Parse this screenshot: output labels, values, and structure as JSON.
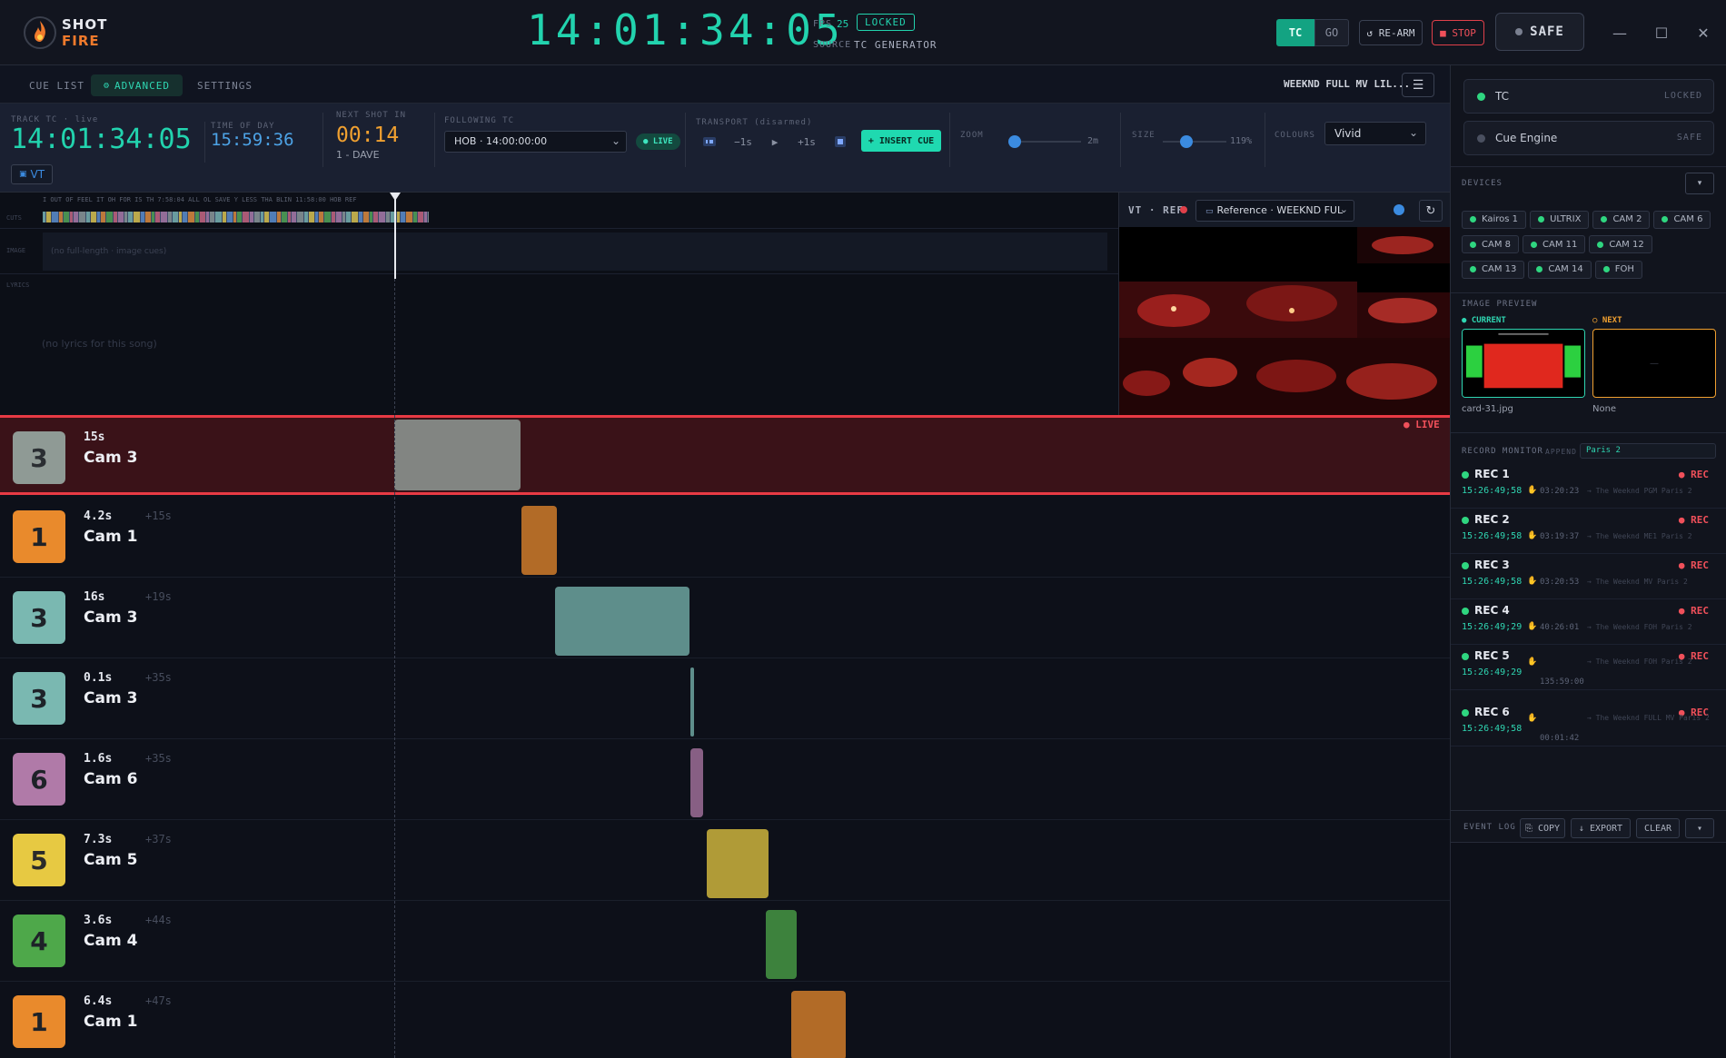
{
  "brand": {
    "line1": "SHOT",
    "line2": "FIRE"
  },
  "header": {
    "timecode": "14:01:34:05",
    "fps_label": "FPS",
    "fps_value": "25",
    "lock_status": "LOCKED",
    "source_label": "SOURCE",
    "source_value": "TC GENERATOR",
    "tc_button": "TC",
    "go_button": "GO",
    "rearm_button": "↺ RE-ARM",
    "stop_button": "■ STOP",
    "safe_button": "SAFE",
    "window": {
      "minimize": "—",
      "maximize": "☐",
      "close": "✕"
    }
  },
  "tabs": [
    {
      "label": "CUE LIST",
      "active": false
    },
    {
      "label": "ADVANCED",
      "active": true
    },
    {
      "label": "SETTINGS",
      "active": false
    }
  ],
  "song_title": "WEEKND FULL MV LIL...",
  "controls": {
    "track_tc_label": "TRACK TC · live",
    "track_tc": "14:01:34:05",
    "time_of_day_label": "TIME OF DAY",
    "time_of_day": "15:59:36",
    "next_shot_label": "NEXT SHOT IN",
    "next_shot": "00:14",
    "next_shot_name": "1 - DAVE",
    "following_label": "FOLLOWING TC",
    "following_value": "HOB · 14:00:00:00",
    "live_label": "● LIVE",
    "transport_label": "TRANSPORT (disarmed)",
    "transport": {
      "back": "−1s",
      "play": "▶",
      "fwd": "+1s"
    },
    "insert_cue": "+ INSERT CUE",
    "zoom_label": "ZOOM",
    "zoom_value": "2m",
    "zoom_level": 0.0,
    "size_label": "SIZE",
    "size_value": "119%",
    "colours_label": "COLOURS",
    "colours_value": "Vivid",
    "vt_button": "VT"
  },
  "timeline": {
    "cuts_label": "CUTS",
    "image_label": "IMAGE",
    "lyrics_label": "LYRICS",
    "cut_labels": "I  OUT OF  FEEL IT  OH FOR  IS TH  7:58:04  ALL OL  SAVE Y  LESS THA  BLIN  11:58:00  HOB   REF",
    "image_empty": "(no full-length · image cues)",
    "lyrics_empty": "(no lyrics for this song)"
  },
  "vt": {
    "title": "VT · REF",
    "source": "Reference · WEEKND FUL",
    "refresh": "↻"
  },
  "cues": [
    {
      "num": "3",
      "duration": "15s",
      "name": "Cam 3",
      "offset": "",
      "color": "#8f9a95",
      "live": true
    },
    {
      "num": "1",
      "duration": "4.2s",
      "name": "Cam 1",
      "offset": "+15s",
      "color": "#e98a2c",
      "live": false
    },
    {
      "num": "3",
      "duration": "16s",
      "name": "Cam 3",
      "offset": "+19s",
      "color": "#7ab8b1",
      "live": false
    },
    {
      "num": "3",
      "duration": "0.1s",
      "name": "Cam 3",
      "offset": "+35s",
      "color": "#7ab8b1",
      "live": false
    },
    {
      "num": "6",
      "duration": "1.6s",
      "name": "Cam 6",
      "offset": "+35s",
      "color": "#b07aa8",
      "live": false
    },
    {
      "num": "5",
      "duration": "7.3s",
      "name": "Cam 5",
      "offset": "+37s",
      "color": "#e7c942",
      "live": false
    },
    {
      "num": "4",
      "duration": "3.6s",
      "name": "Cam 4",
      "offset": "+44s",
      "color": "#4ea84a",
      "live": false
    },
    {
      "num": "1",
      "duration": "6.4s",
      "name": "Cam 1",
      "offset": "+47s",
      "color": "#e98a2c",
      "live": false
    }
  ],
  "live_tag": "● LIVE",
  "status": [
    {
      "name": "TC",
      "state": "LOCKED",
      "color": "#2fd680"
    },
    {
      "name": "Cue Engine",
      "state": "SAFE",
      "color": "#4a5060"
    }
  ],
  "devices_label": "DEVICES",
  "devices": [
    "Kairos 1",
    "ULTRIX",
    "CAM 2",
    "CAM 6",
    "CAM 8",
    "CAM 11",
    "CAM 12",
    "CAM 13",
    "CAM 14",
    "FOH"
  ],
  "image_preview": {
    "label": "IMAGE PREVIEW",
    "current_label": "● CURRENT",
    "next_label": "○ NEXT",
    "current_file": "card-31.jpg",
    "next_file": "None",
    "next_dash": "—"
  },
  "record_monitor": {
    "label": "RECORD MONITOR",
    "append_label": "APPEND",
    "append_value": "Paris 2",
    "rec_tag": "● REC",
    "recorders": [
      {
        "name": "REC 1",
        "time": "15:26:49;58",
        "duration": "03:20:23",
        "file": "→ The Weeknd PGM Paris 2"
      },
      {
        "name": "REC 2",
        "time": "15:26:49;58",
        "duration": "03:19:37",
        "file": "→ The Weeknd ME1 Paris 2"
      },
      {
        "name": "REC 3",
        "time": "15:26:49;58",
        "duration": "03:20:53",
        "file": "→ The Weeknd MV Paris 2"
      },
      {
        "name": "REC 4",
        "time": "15:26:49;29",
        "duration": "40:26:01",
        "file": "→ The Weeknd FOH Paris 2"
      },
      {
        "name": "REC 5",
        "time": "15:26:49;29",
        "duration": "135:59:00",
        "file": "→ The Weeknd FOH Paris 2"
      },
      {
        "name": "REC 6",
        "time": "15:26:49;58",
        "duration": "00:01:42",
        "file": "→ The Weeknd FULL MV Paris 2"
      }
    ]
  },
  "event_log": {
    "label": "EVENT LOG",
    "copy": "⎘ COPY",
    "export": "↓ EXPORT",
    "clear": "CLEAR",
    "more": "▾"
  }
}
